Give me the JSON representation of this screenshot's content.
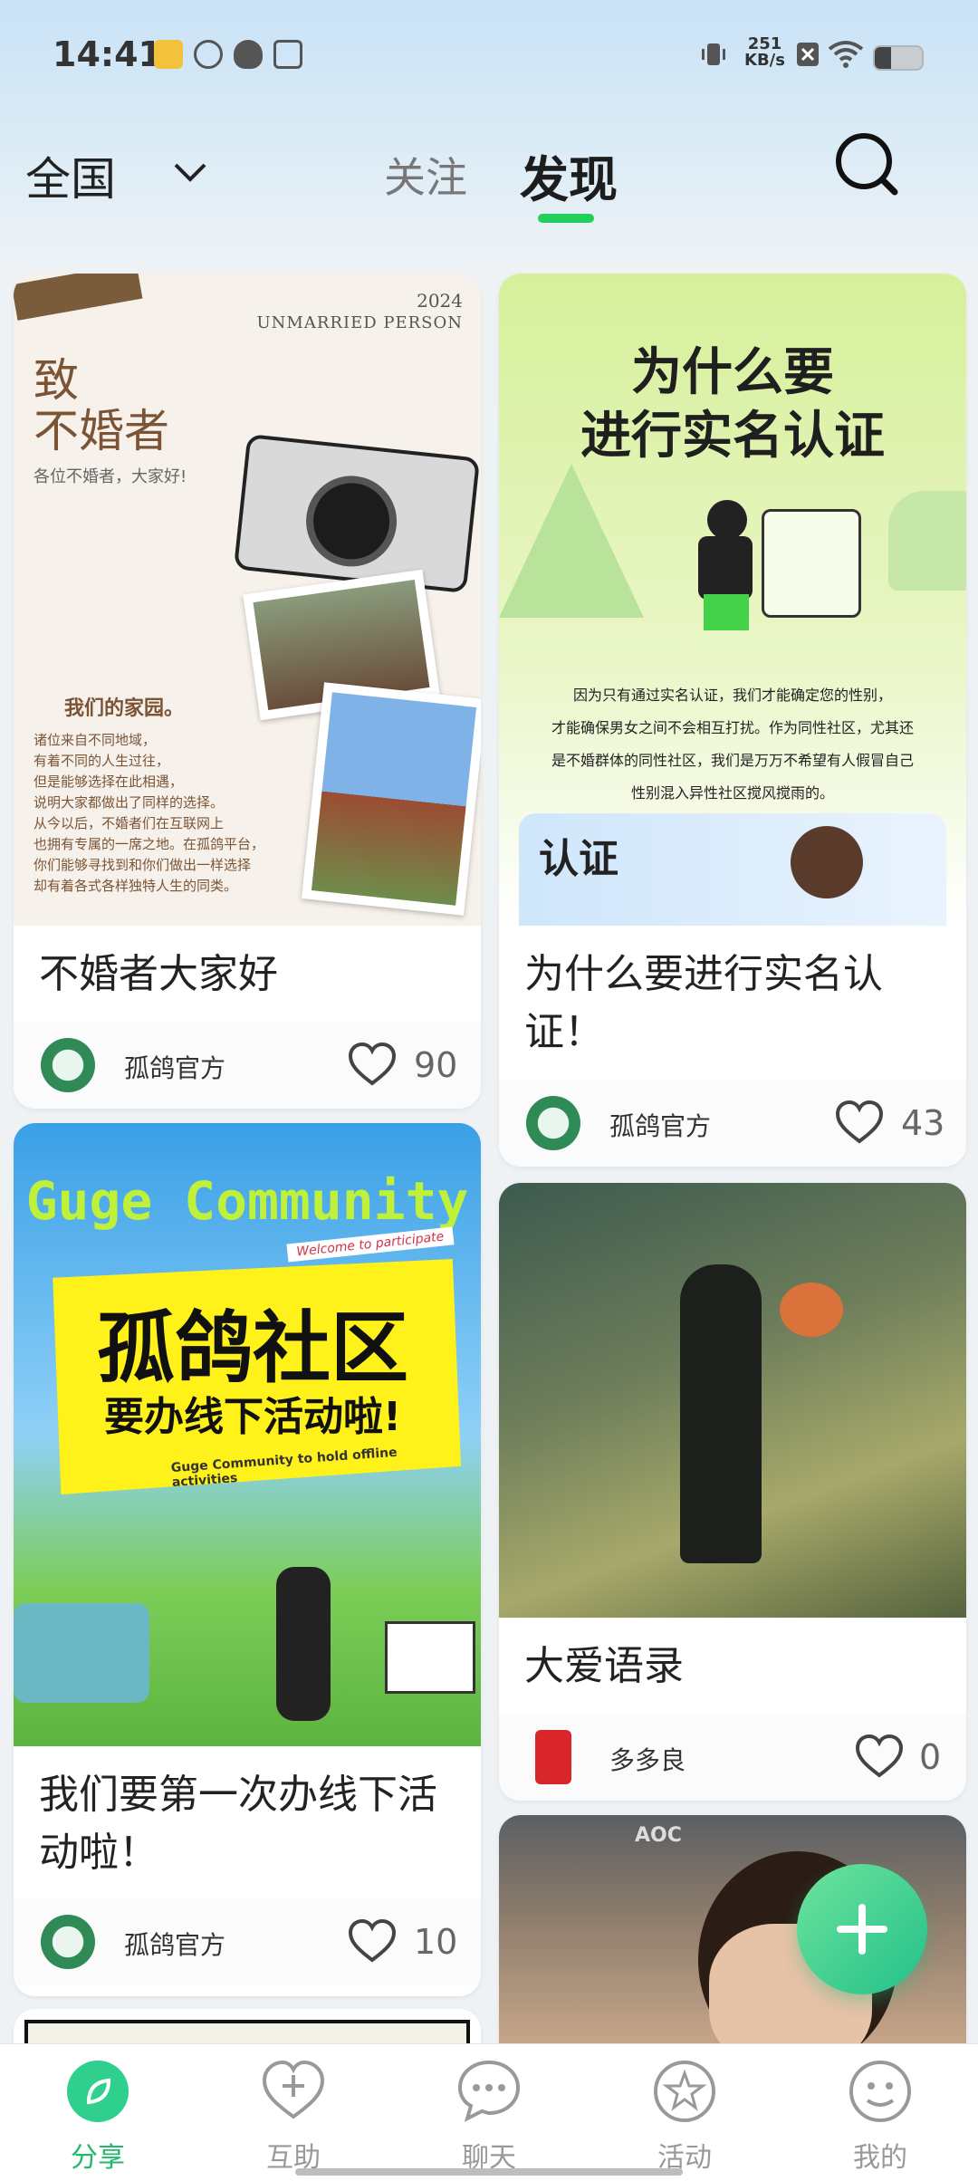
{
  "status_bar": {
    "time": "14:41",
    "speed_value": "251",
    "speed_unit": "KB/s"
  },
  "header": {
    "region": "全国",
    "tabs": {
      "follow": "关注",
      "discover": "发现"
    }
  },
  "feed": {
    "card1": {
      "image": {
        "year": "2024",
        "subtitle": "UNMARRIED PERSON",
        "heading_line1": "致",
        "heading_line2": "不婚者",
        "greeting": "各位不婚者，大家好!",
        "section": "我们的家园。",
        "body": [
          "诸位来自不同地域，",
          "有着不同的人生过往，",
          "但是能够选择在此相遇，",
          "说明大家都做出了同样的选择。",
          "从今以后，不婚者们在互联网上",
          "也拥有专属的一席之地。在孤鸽平台，",
          "你们能够寻找到和你们做出一样选择",
          "却有着各式各样独特人生的同类。"
        ]
      },
      "title": "不婚者大家好",
      "author": "孤鸽官方",
      "likes": "90"
    },
    "card2": {
      "image": {
        "heading_line1": "为什么要",
        "heading_line2": "进行实名认证",
        "body": [
          "因为只有通过实名认证，我们才能确定您的性别，",
          "才能确保男女之间不会相互打扰。作为同性社区，尤其还",
          "是不婚群体的同性社区，我们是万万不希望有人假冒自己",
          "性别混入异性社区搅风搅雨的。"
        ],
        "badge": "认证"
      },
      "title": "为什么要进行实名认证！",
      "author": "孤鸽官方",
      "likes": "43"
    },
    "card3": {
      "image": {
        "brand": "Guge Community",
        "ribbon": "Welcome to participate",
        "heading_line1": "孤鸽社区",
        "heading_line2": "要办线下活动啦!",
        "caption": "Guge Community to hold offline activities"
      },
      "title": "我们要第一次办线下活动啦！",
      "author": "孤鸽官方",
      "likes": "10"
    },
    "card4": {
      "title": "大爱语录",
      "author": "多多良",
      "likes": "0"
    },
    "card5": {
      "image": {
        "monitor_brand": "AOC"
      }
    }
  },
  "bottom_nav": [
    "分享",
    "互助",
    "聊天",
    "活动",
    "我的"
  ],
  "colors": {
    "accent_green": "#22cf5a",
    "fab": "#2fd08e"
  },
  "icons": [
    "search-icon",
    "chevron-down-icon",
    "heart-icon",
    "plus-icon",
    "share-icon",
    "help-icon",
    "chat-icon",
    "activity-icon",
    "profile-icon"
  ]
}
